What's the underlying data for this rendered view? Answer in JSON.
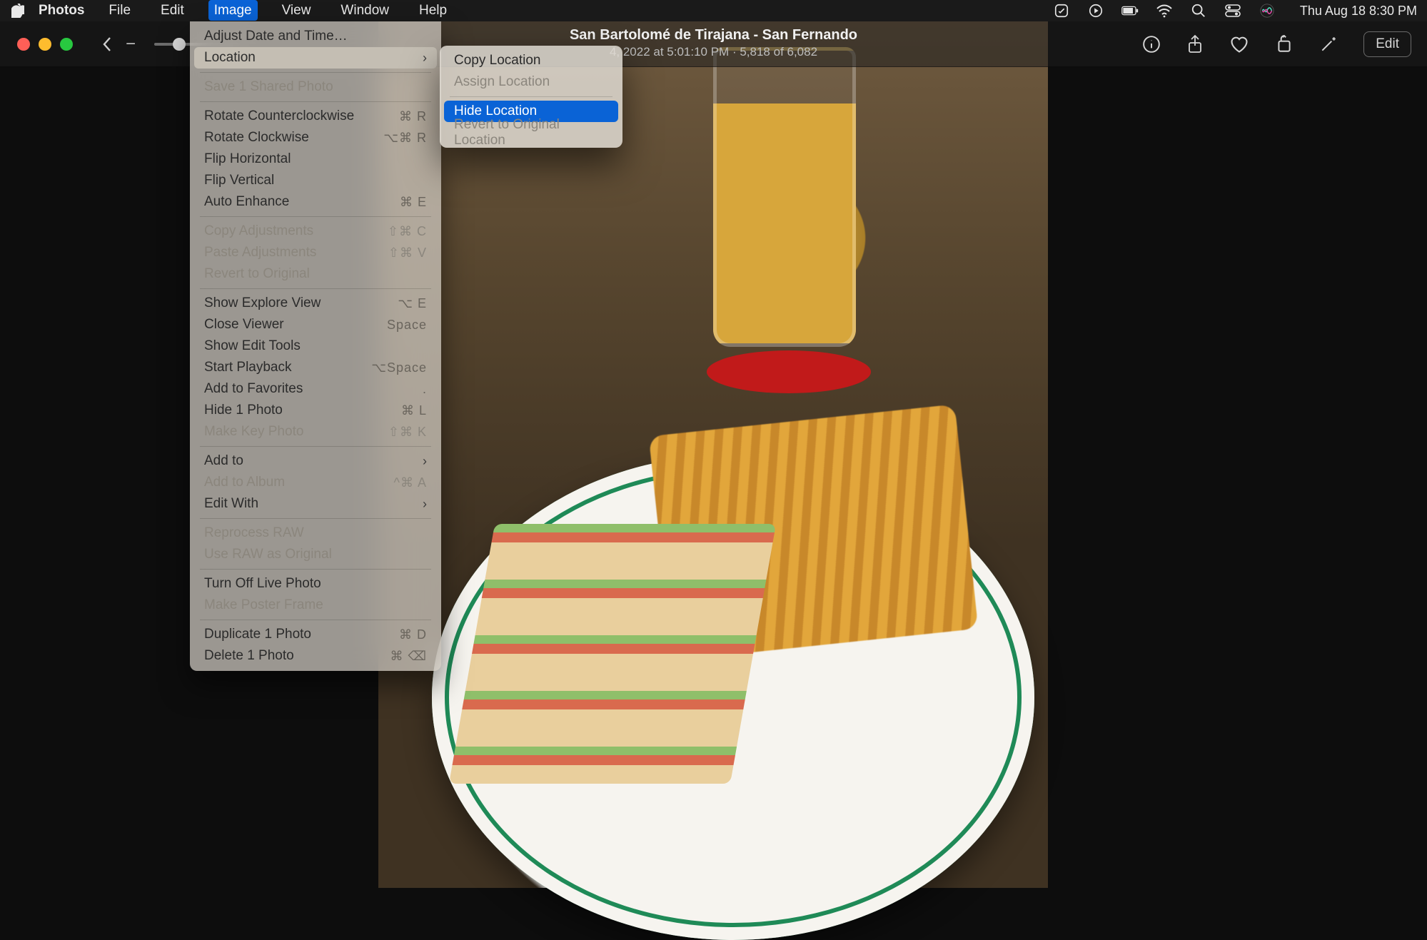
{
  "menubar": {
    "app": "Photos",
    "items": [
      "File",
      "Edit",
      "Image",
      "View",
      "Window",
      "Help"
    ],
    "active_index": 2,
    "datetime": "Thu Aug 18  8:30 PM"
  },
  "toolbar": {
    "title": "San Bartolomé de Tirajana - San Fernando",
    "date": "4, 2022 at 5:01:10 PM",
    "counter": "5,818 of 6,082",
    "edit": "Edit"
  },
  "image_menu": {
    "groups": [
      [
        {
          "label": "Adjust Date and Time…",
          "shortcut": "",
          "disabled": false,
          "submenu": false
        },
        {
          "label": "Location",
          "shortcut": "",
          "disabled": false,
          "submenu": true,
          "selected": true
        }
      ],
      [
        {
          "label": "Save 1 Shared Photo",
          "shortcut": "",
          "disabled": true,
          "submenu": false
        }
      ],
      [
        {
          "label": "Rotate Counterclockwise",
          "shortcut": "⌘ R",
          "disabled": false
        },
        {
          "label": "Rotate Clockwise",
          "shortcut": "⌥⌘ R",
          "disabled": false
        },
        {
          "label": "Flip Horizontal",
          "shortcut": "",
          "disabled": false
        },
        {
          "label": "Flip Vertical",
          "shortcut": "",
          "disabled": false
        },
        {
          "label": "Auto Enhance",
          "shortcut": "⌘ E",
          "disabled": false
        }
      ],
      [
        {
          "label": "Copy Adjustments",
          "shortcut": "⇧⌘ C",
          "disabled": true
        },
        {
          "label": "Paste Adjustments",
          "shortcut": "⇧⌘ V",
          "disabled": true
        },
        {
          "label": "Revert to Original",
          "shortcut": "",
          "disabled": true
        }
      ],
      [
        {
          "label": "Show Explore View",
          "shortcut": "⌥ E",
          "disabled": false
        },
        {
          "label": "Close Viewer",
          "shortcut": "Space",
          "disabled": false
        },
        {
          "label": "Show Edit Tools",
          "shortcut": "",
          "disabled": false
        },
        {
          "label": "Start Playback",
          "shortcut": "⌥Space",
          "disabled": false
        },
        {
          "label": "Add to Favorites",
          "shortcut": ".",
          "disabled": false
        },
        {
          "label": "Hide 1 Photo",
          "shortcut": "⌘ L",
          "disabled": false
        },
        {
          "label": "Make Key Photo",
          "shortcut": "⇧⌘ K",
          "disabled": true
        }
      ],
      [
        {
          "label": "Add to",
          "shortcut": "",
          "disabled": false,
          "submenu": true
        },
        {
          "label": "Add to Album",
          "shortcut": "^⌘ A",
          "disabled": true
        },
        {
          "label": "Edit With",
          "shortcut": "",
          "disabled": false,
          "submenu": true
        }
      ],
      [
        {
          "label": "Reprocess RAW",
          "shortcut": "",
          "disabled": true
        },
        {
          "label": "Use RAW as Original",
          "shortcut": "",
          "disabled": true
        }
      ],
      [
        {
          "label": "Turn Off Live Photo",
          "shortcut": "",
          "disabled": false
        },
        {
          "label": "Make Poster Frame",
          "shortcut": "",
          "disabled": true
        }
      ],
      [
        {
          "label": "Duplicate 1 Photo",
          "shortcut": "⌘ D",
          "disabled": false
        },
        {
          "label": "Delete 1 Photo",
          "shortcut": "⌘ ⌫",
          "disabled": false
        }
      ]
    ]
  },
  "location_submenu": {
    "groups": [
      [
        {
          "label": "Copy Location",
          "disabled": false,
          "highlight": false
        },
        {
          "label": "Assign Location",
          "disabled": true,
          "highlight": false
        }
      ],
      [
        {
          "label": "Hide Location",
          "disabled": false,
          "highlight": true
        },
        {
          "label": "Revert to Original Location",
          "disabled": true,
          "highlight": false
        }
      ]
    ]
  }
}
